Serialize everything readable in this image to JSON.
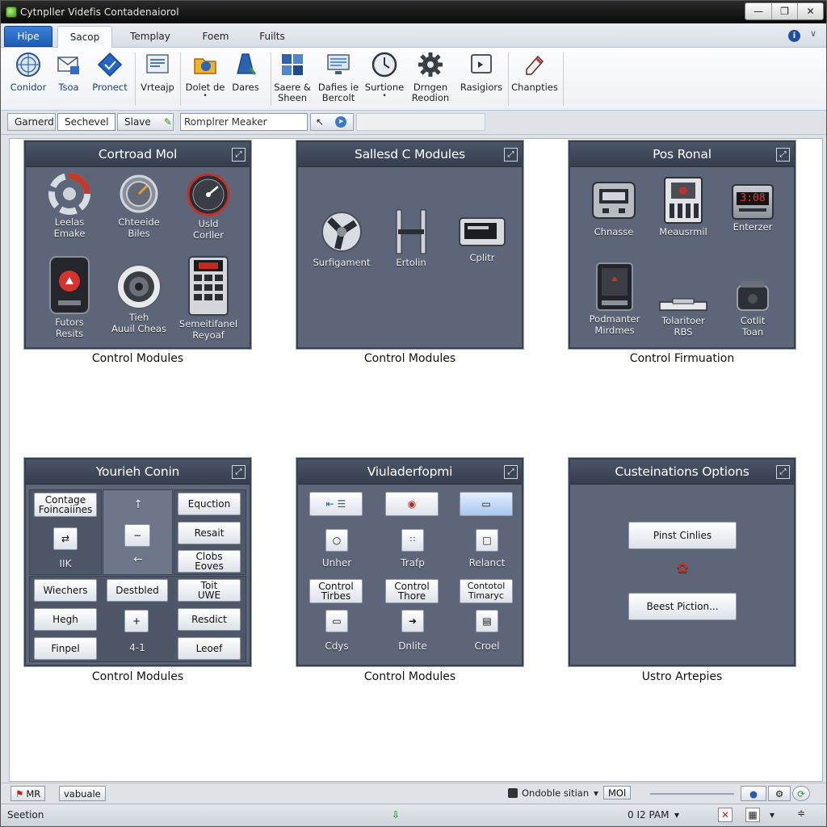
{
  "window": {
    "title": "Cytnpller Videfis Contadenaiorol"
  },
  "tabs": [
    {
      "label": "Hipe"
    },
    {
      "label": "Sacop"
    },
    {
      "label": "Templay"
    },
    {
      "label": "Foem"
    },
    {
      "label": "Fuilts"
    }
  ],
  "ribbon": [
    {
      "label": "Conidor"
    },
    {
      "label": "Tsoa"
    },
    {
      "label": "Pronect"
    },
    {
      "label": "Vrteajp"
    },
    {
      "label": "Dolet de",
      "sub": "•"
    },
    {
      "label": "Dares"
    },
    {
      "label": "Saere &\nSheen"
    },
    {
      "label": "Dafies ie\nBercolt"
    },
    {
      "label": "Surtione",
      "sub": "•"
    },
    {
      "label": "Drngen\nReodion"
    },
    {
      "label": "Rasigiors"
    },
    {
      "label": "Chanpties"
    }
  ],
  "toolbar": {
    "btn1": "Garnerd",
    "btn2": "Sechevel",
    "btn3": "Slave",
    "search_value": "Romplrer Meaker"
  },
  "panels": {
    "p1": {
      "title": "Cortroad Mol",
      "caption": "Control Modules",
      "items": [
        "Leelas\nEmake",
        "Chteeide\nBiles",
        "Usld\nCorller",
        "Futors\nResits",
        "Tieh\nAuuil Cheas",
        "Semeitifanel\nReyoaf"
      ]
    },
    "p2": {
      "title": "Sallesd C Modules",
      "caption": "Control Modules",
      "items": [
        "Surfigament",
        "Ertolin",
        "Cplitr"
      ]
    },
    "p3": {
      "title": "Pos Ronal",
      "caption": "Control Firmuation",
      "items": [
        "Chnasse",
        "Meausrmil",
        "Enterzer",
        "Podmanter\nMirdmes",
        "Tolaritoer\nRBS",
        "Cotlit\nToan"
      ],
      "clock": "3:08"
    },
    "p4": {
      "title": "Yourieh Conin",
      "caption": "Control Modules",
      "buttons": [
        "Contage\nFoincaiines",
        "Equction",
        "Resait",
        "Clobs\nEoves",
        "Wiechers",
        "Destbled",
        "Toit\nUWE",
        "Hegh",
        "Resdict",
        "Finpel",
        "Leoef"
      ],
      "labels": [
        "IIK",
        "4-1"
      ]
    },
    "p5": {
      "title": "Viuladerfopmi",
      "caption": "Control Modules",
      "labels": [
        "Unher",
        "Trafp",
        "Relanct",
        "Cdys",
        "Dnlite",
        "Croel"
      ],
      "buttons": [
        "Control\nTirbes",
        "Control\nThore",
        "Contotol\nTimaryc"
      ]
    },
    "p6": {
      "title": "Custeinations Options",
      "caption": "Ustro Artepies",
      "buttons": [
        "Pinst Cinlies",
        "Beest Piction..."
      ]
    }
  },
  "statusbar": {
    "left_badge": "MR",
    "left_btn": "vabuale",
    "mode": "Ondoble sitian",
    "mode2": "MOl"
  },
  "bottombar": {
    "left": "Seetion",
    "time": "0 I2 PAM"
  }
}
